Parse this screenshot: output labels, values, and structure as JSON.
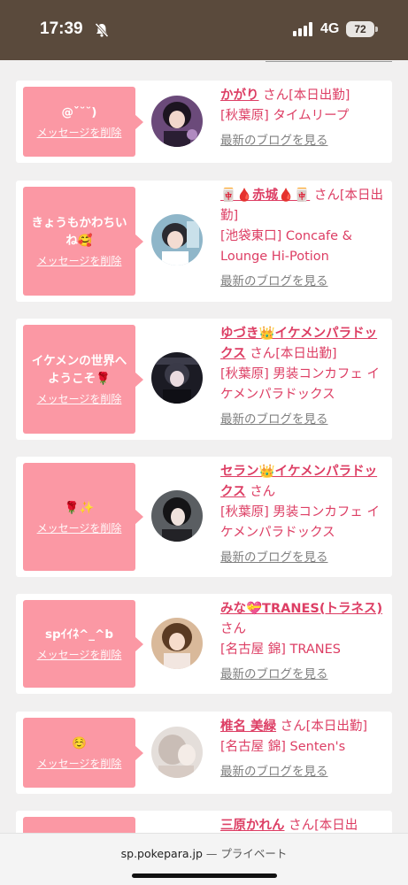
{
  "status": {
    "time": "17:39",
    "network": "4G",
    "battery": "72"
  },
  "browser": {
    "domain": "sp.pokepara.jp",
    "label": "— プライベート"
  },
  "common": {
    "delete_label": "メッセージを削除",
    "blog_label": "最新のブログを見る",
    "honorific": "さん"
  },
  "cards": [
    {
      "message": "@ˇ˘˘)",
      "name": "かがり",
      "status": "[本日出勤]",
      "shop": "[秋葉原] タイムリープ"
    },
    {
      "message": "きょうもかわちいね🥰",
      "name": "🀄🩸赤城🩸🀄",
      "status": "[本日出勤]",
      "shop": "[池袋東口] Concafe & Lounge Hi-Potion"
    },
    {
      "message": "イケメンの世界へようこそ🌹",
      "name": "ゆづき👑イケメンパラドックス",
      "status": "[本日出勤]",
      "shop": "[秋葉原] 男装コンカフェ イケメンパラドックス"
    },
    {
      "message": "🌹✨",
      "name": "セラン👑イケメンパラドックス",
      "status": "",
      "shop": "[秋葉原] 男装コンカフェ イケメンパラドックス"
    },
    {
      "message": "spｲｲﾈ^_^b",
      "name": "みな💝TRANES(トラネス)",
      "status": "",
      "shop": "[名古屋 錦] TRANES"
    },
    {
      "message": "☺️",
      "name": "椎名 美緑",
      "status": "[本日出勤]",
      "shop": "[名古屋 錦] Senten's"
    },
    {
      "message": "",
      "name": "三原かれん",
      "status": "[本日出",
      "shop": ""
    }
  ]
}
